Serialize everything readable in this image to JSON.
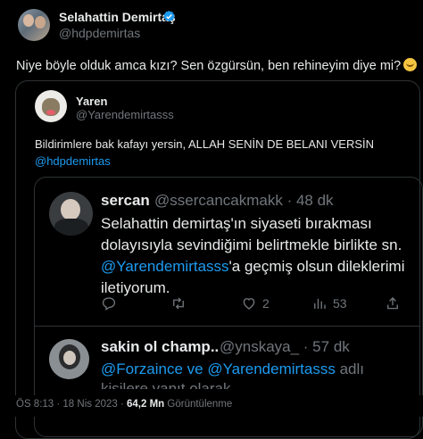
{
  "tweet": {
    "author_name": "Selahattin Demirtaş",
    "author_handle": "@hdpdemirtas",
    "text": "Niye böyle olduk amca kızı? Sen özgürsün, ben rehineyim diye mi?",
    "timestamp": "ÖS 8:13 · 18 Nis 2023 · ",
    "views_count": "64,2 Mn",
    "views_label": " Görüntülenme"
  },
  "quote": {
    "author_name": "Yaren",
    "author_handle": "@Yarendemirtasss",
    "text_line1": "Bildirimlere bak kafayı yersin, ALLAH SENİN DE BELANI VERSİN",
    "mention": "@hdpdemirtas"
  },
  "reply1": {
    "author_name": "sercan",
    "author_handle": "@ssercancakmakk · 48 dk",
    "text_a": "Selahattin demirtaş'ın siyaseti bırakması dolayısıyla sevindiğimi belirtmekle birlikte sn. ",
    "mention": "@Yarendemirtasss",
    "text_b": "'a geçmiş olsun dileklerimi iletiyorum.",
    "replies": "",
    "retweets": "",
    "likes": "2",
    "views": "53"
  },
  "reply2": {
    "author_name": "sakin ol champ..",
    "author_handle": "@ynskaya_ · 57 dk",
    "mention1": "@Forzaince",
    "connector": " ve ",
    "mention2": "@Yarendemirtasss",
    "text_tail": " adlı",
    "text_line2": "kişilere yanıt olarak"
  },
  "colors": {
    "background": "#000000",
    "text": "#e7e9ea",
    "secondary": "#71767b",
    "link": "#1d9bf0",
    "border": "#2f3336",
    "verified": "#1d9bf0"
  },
  "icons": [
    "verified-badge-icon",
    "smile-emoji-icon",
    "reply-icon",
    "retweet-icon",
    "like-icon",
    "views-icon",
    "share-icon"
  ]
}
